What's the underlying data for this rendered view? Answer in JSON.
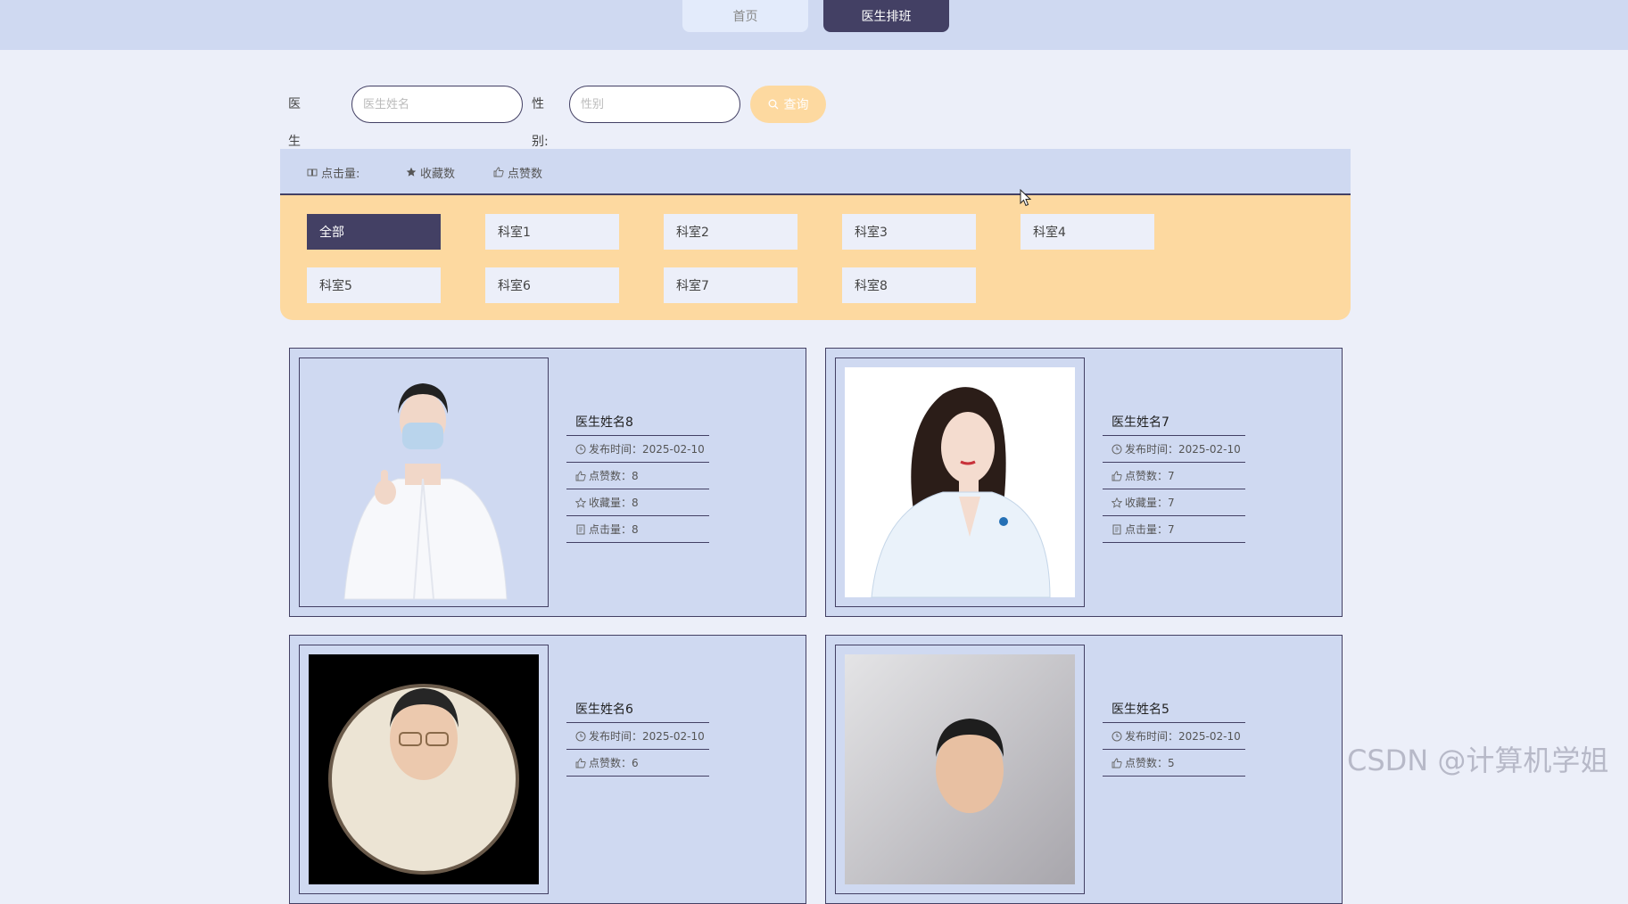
{
  "nav": {
    "home_label": "首页",
    "schedule_label": "医生排班"
  },
  "search": {
    "name_label": "医生姓名:",
    "name_placeholder": "医生姓名",
    "gender_label": "性别:",
    "gender_placeholder": "性别",
    "button_label": "查询"
  },
  "sort": {
    "clicks_label": "点击量:",
    "favorites_label": "收藏数",
    "likes_label": "点赞数"
  },
  "categories": [
    "全部",
    "科室1",
    "科室2",
    "科室3",
    "科室4",
    "科室5",
    "科室6",
    "科室7",
    "科室8"
  ],
  "doctors": [
    {
      "name": "医生姓名8",
      "publish": "发布时间：2025-02-10",
      "likes": "点赞数：8",
      "favorites": "收藏量：8",
      "clicks": "点击量：8"
    },
    {
      "name": "医生姓名7",
      "publish": "发布时间：2025-02-10",
      "likes": "点赞数：7",
      "favorites": "收藏量：7",
      "clicks": "点击量：7"
    },
    {
      "name": "医生姓名6",
      "publish": "发布时间：2025-02-10",
      "likes": "点赞数：6"
    },
    {
      "name": "医生姓名5",
      "publish": "发布时间：2025-02-10",
      "likes": "点赞数：5"
    }
  ],
  "watermark": "CSDN @计算机学姐",
  "colors": {
    "primary": "#434064",
    "accent": "#fdd9a0",
    "panel": "#cfd9f1",
    "background": "#eceff9"
  }
}
